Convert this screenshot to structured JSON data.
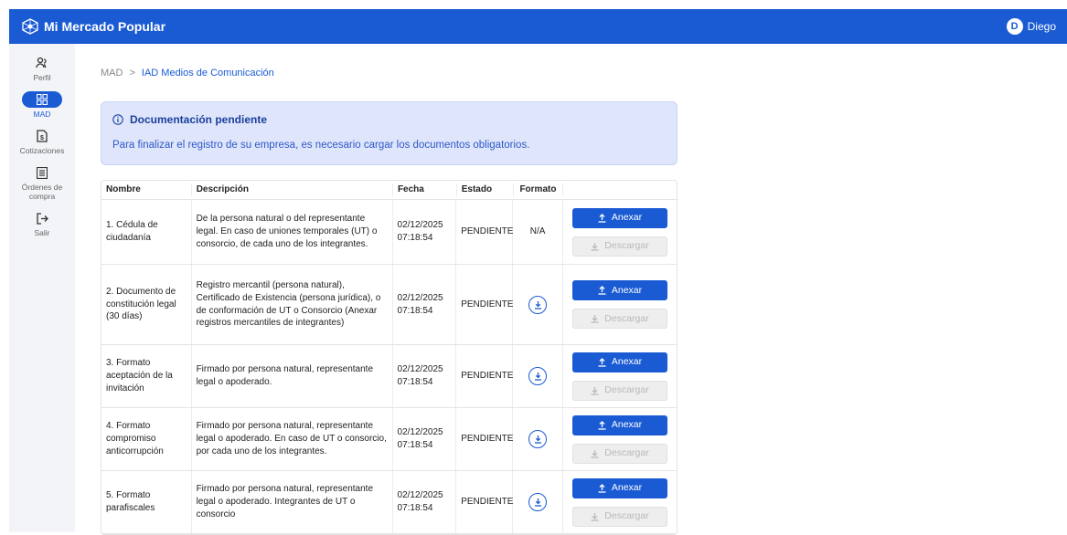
{
  "app": {
    "title": "Mi Mercado Popular"
  },
  "user": {
    "initial": "D",
    "name": "Diego"
  },
  "sidebar": {
    "items": [
      {
        "label": "Perfil",
        "icon": "profile-icon"
      },
      {
        "label": "MAD",
        "icon": "grid-icon",
        "active": true
      },
      {
        "label": "Cotizaciones",
        "icon": "document-icon"
      },
      {
        "label": "Órdenes de compra",
        "icon": "list-icon"
      },
      {
        "label": "Salir",
        "icon": "logout-icon"
      }
    ]
  },
  "breadcrumb": {
    "root": "MAD",
    "separator": ">",
    "current": "IAD Medios de Comunicación"
  },
  "alert": {
    "title": "Documentación pendiente",
    "text": "Para finalizar el registro de su empresa, es necesario cargar los documentos obligatorios."
  },
  "table": {
    "headers": [
      "Nombre",
      "Descripción",
      "Fecha",
      "Estado",
      "Formato",
      ""
    ],
    "rows": [
      {
        "nombre": "1. Cédula de ciudadanía",
        "descripcion": "De la persona natural o del representante legal. En caso de uniones temporales (UT) o consorcio, de cada uno de los integrantes.",
        "fecha": "02/12/2025 07:18:54",
        "estado": "PENDIENTE",
        "formato": "N/A"
      },
      {
        "nombre": "2. Documento de constitución legal (30 días)",
        "descripcion": "Registro mercantil (persona natural), Certificado de Existencia (persona jurídica), o de conformación de UT o Consorcio (Anexar registros mercantiles de integrantes)",
        "fecha": "02/12/2025 07:18:54",
        "estado": "PENDIENTE",
        "formato": ""
      },
      {
        "nombre": "3. Formato aceptación de la invitación",
        "descripcion": "Firmado por persona natural, representante legal o apoderado.",
        "fecha": "02/12/2025 07:18:54",
        "estado": "PENDIENTE",
        "formato": ""
      },
      {
        "nombre": "4. Formato compromiso anticorrupción",
        "descripcion": "Firmado por persona natural, representante legal o apoderado. En caso de UT o consorcio, por cada uno de los integrantes.",
        "fecha": "02/12/2025 07:18:54",
        "estado": "PENDIENTE",
        "formato": ""
      },
      {
        "nombre": "5. Formato parafiscales",
        "descripcion": "Firmado por persona natural, representante legal o apoderado. Integrantes de UT o consorcio",
        "fecha": "02/12/2025 07:18:54",
        "estado": "PENDIENTE",
        "formato": ""
      }
    ],
    "actions": {
      "anexar": "Anexar",
      "descargar": "Descargar"
    }
  },
  "colors": {
    "primary": "#1a5bd4",
    "alert_bg": "#dfe6fb",
    "sidebar_bg": "#f2f4f8"
  }
}
